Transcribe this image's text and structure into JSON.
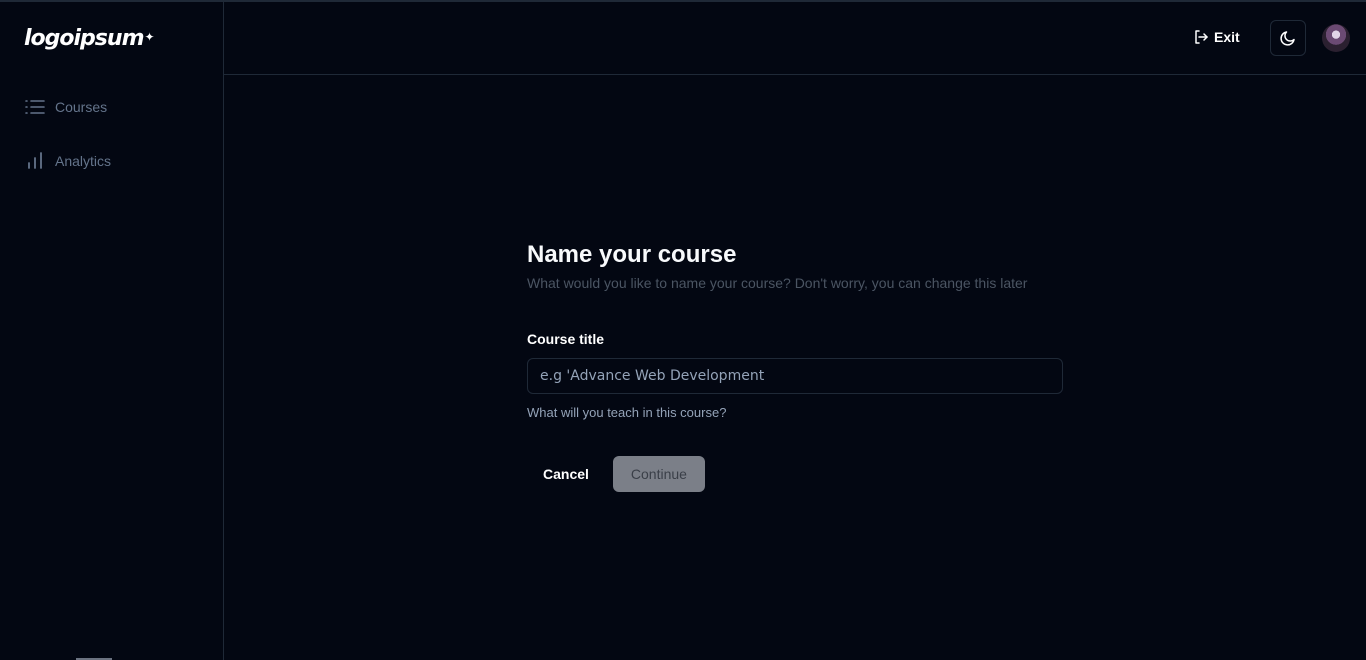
{
  "app": {
    "logo_text": "logoipsum"
  },
  "sidebar": {
    "items": [
      {
        "label": "Courses",
        "icon": "list-icon"
      },
      {
        "label": "Analytics",
        "icon": "bar-chart-icon"
      }
    ]
  },
  "header": {
    "exit_label": "Exit",
    "theme_icon": "moon-icon",
    "avatar_icon": "avatar"
  },
  "main": {
    "title": "Name your course",
    "subtitle": "What would you like to name your course? Don't worry, you can change this later",
    "field_label": "Course title",
    "input_placeholder": "e.g 'Advance Web Development",
    "input_value": "",
    "helper_text": "What will you teach in this course?",
    "cancel_label": "Cancel",
    "continue_label": "Continue"
  },
  "colors": {
    "background": "#030712",
    "border": "#1f2937",
    "muted_text": "#64748b",
    "disabled_button": "#7b7f88"
  }
}
